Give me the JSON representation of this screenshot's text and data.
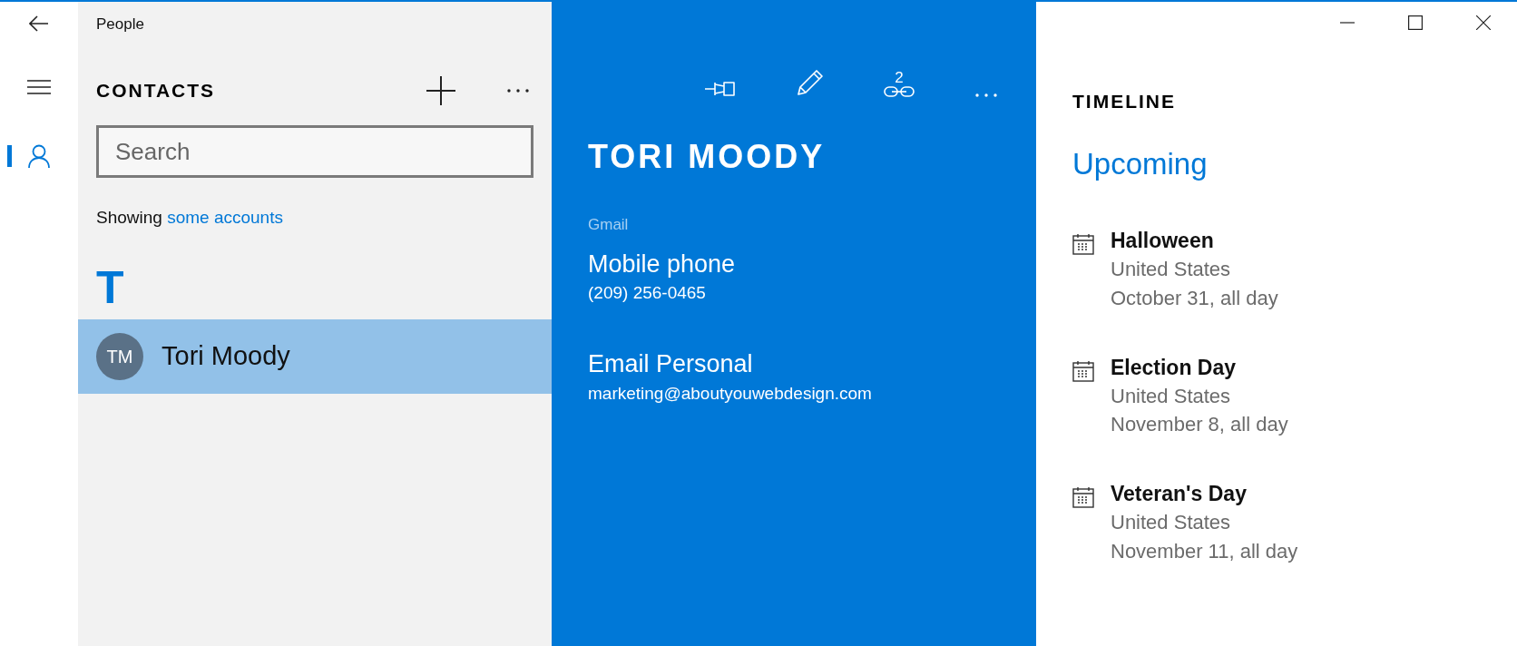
{
  "window": {
    "title": "People"
  },
  "nav": [
    {
      "kind": "menu",
      "selected": false
    },
    {
      "kind": "people",
      "selected": true
    }
  ],
  "contacts": {
    "title": "CONTACTS",
    "search": {
      "placeholder": "Search"
    },
    "filter": {
      "text": "Showing",
      "link": "some accounts"
    },
    "groups": [
      {
        "letter": "T",
        "items": [
          {
            "initials": "TM",
            "name": "Tori Moody",
            "selected": true
          }
        ]
      }
    ]
  },
  "detail": {
    "linked_count": "2",
    "name": "TORI MOODY",
    "account": "Gmail",
    "fields": [
      {
        "label": "Mobile phone",
        "value": "(209) 256-0465"
      },
      {
        "label": "Email Personal",
        "value": "marketing@aboutyouwebdesign.com"
      }
    ]
  },
  "timeline": {
    "title": "TIMELINE",
    "section": "Upcoming",
    "events": [
      {
        "title": "Halloween",
        "place": "United States",
        "date": "October 31, all day"
      },
      {
        "title": "Election Day",
        "place": "United States",
        "date": "November 8, all day"
      },
      {
        "title": "Veteran's Day",
        "place": "United States",
        "date": "November 11, all day"
      }
    ]
  }
}
